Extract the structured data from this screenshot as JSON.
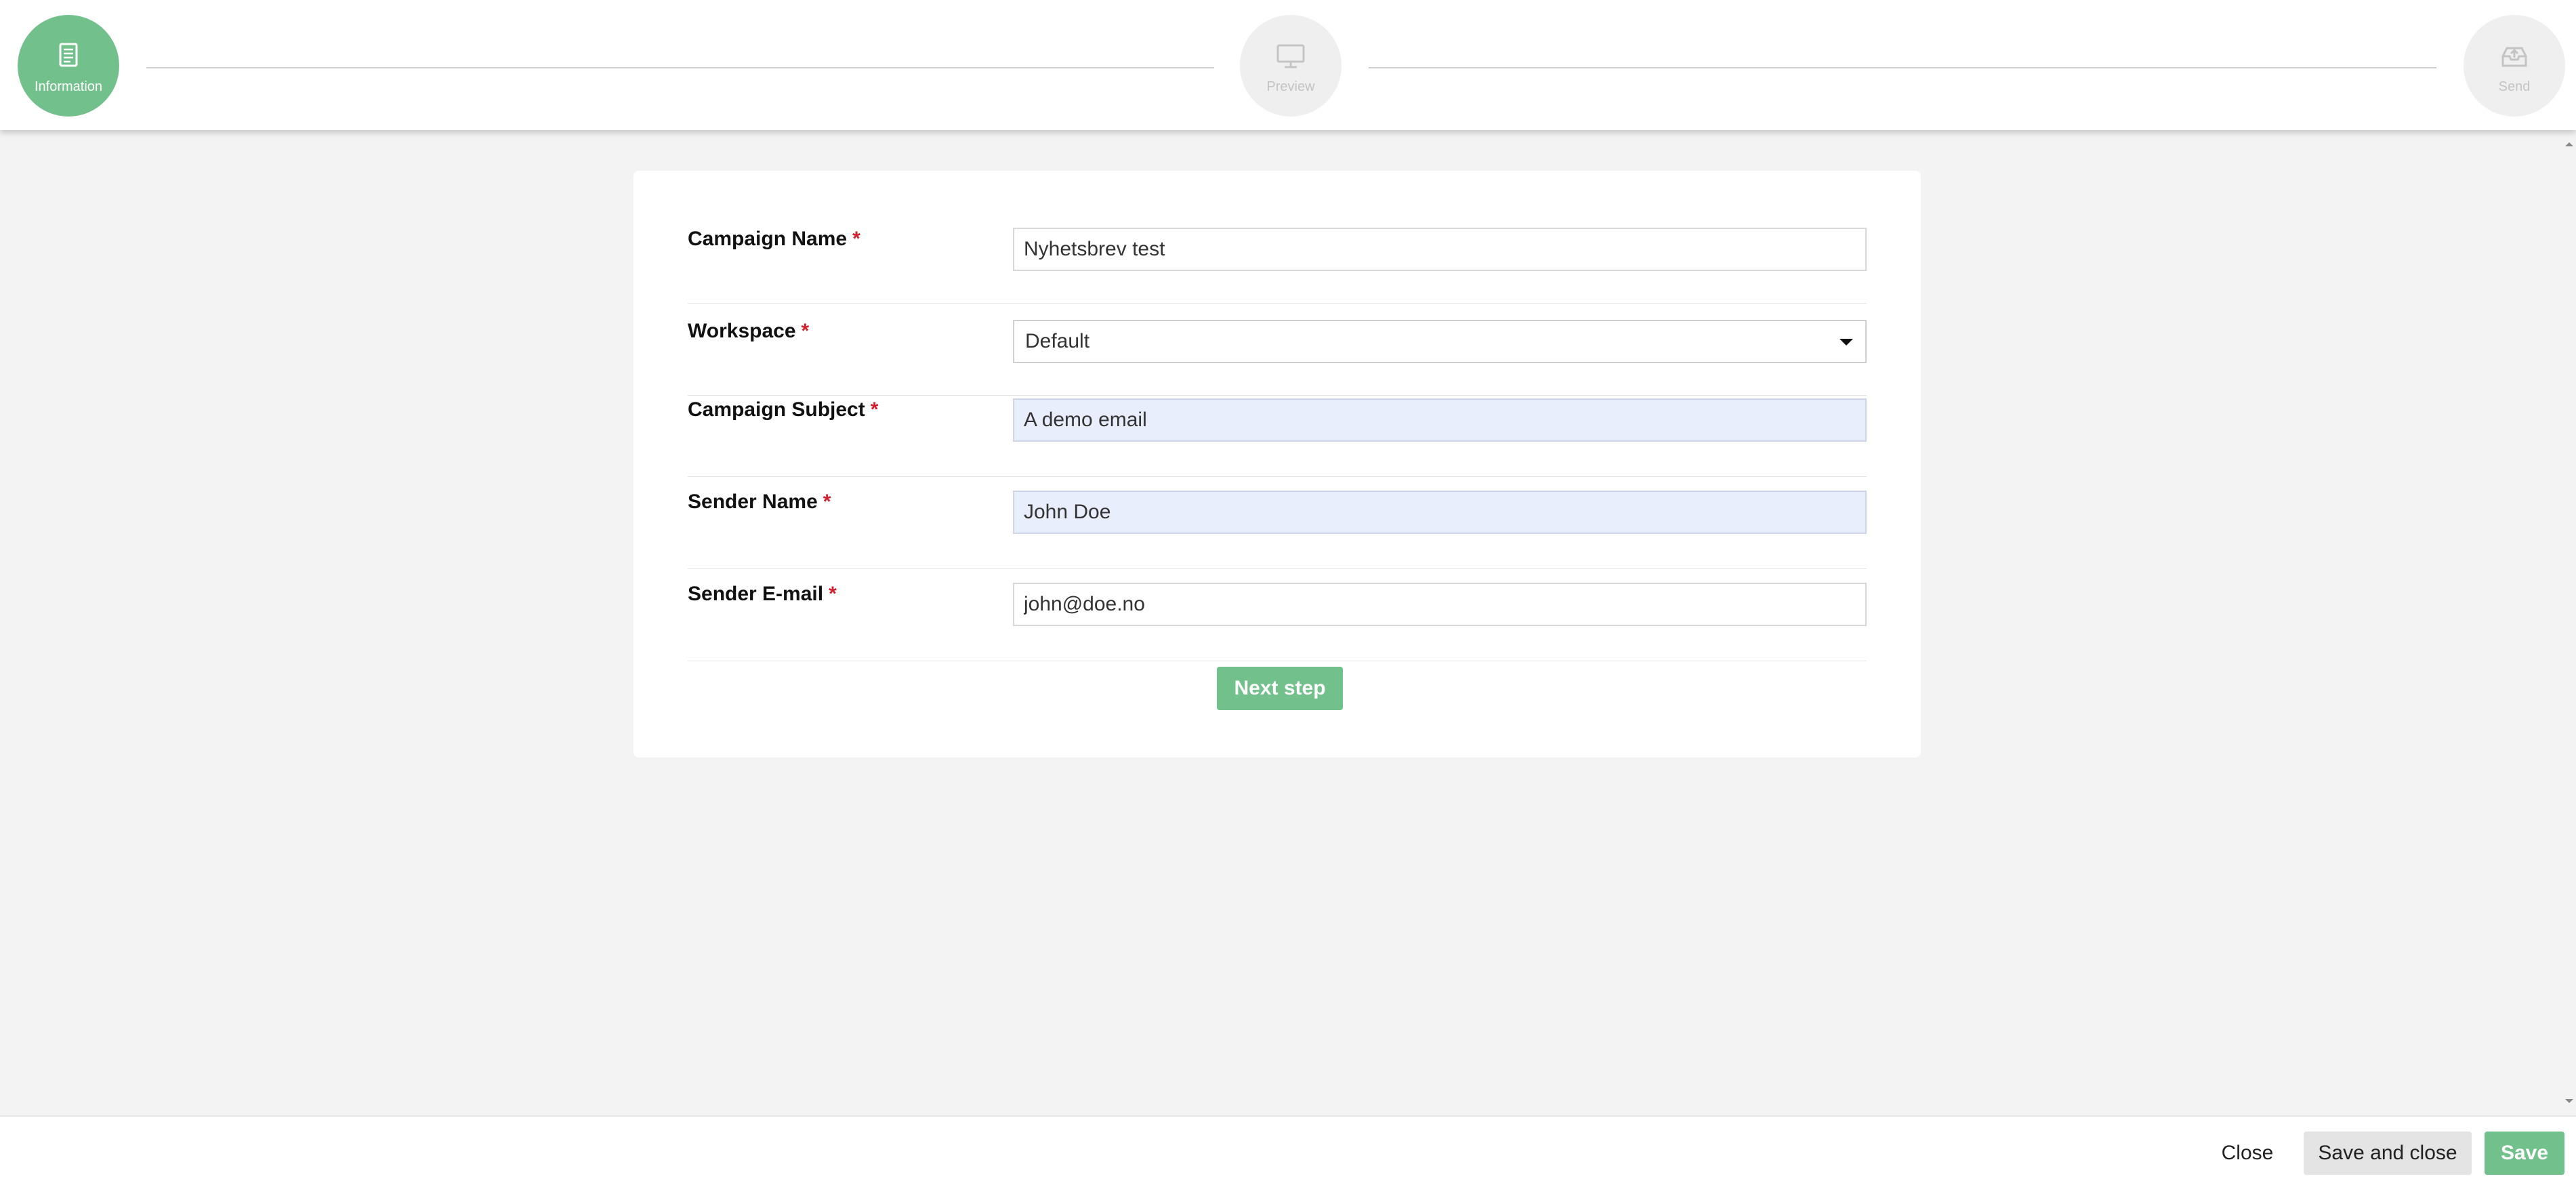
{
  "stepper": {
    "steps": [
      {
        "label": "Information",
        "icon": "document-icon",
        "state": "active"
      },
      {
        "label": "Preview",
        "icon": "monitor-icon",
        "state": "inactive"
      },
      {
        "label": "Send",
        "icon": "inbox-upload-icon",
        "state": "inactive"
      }
    ]
  },
  "form": {
    "fields": [
      {
        "label": "Campaign Name",
        "required": "*",
        "value": "Nyhetsbrev test"
      },
      {
        "label": "Workspace",
        "required": "*",
        "value": "Default"
      },
      {
        "label": "Campaign Subject",
        "required": "*",
        "value": "A demo email"
      },
      {
        "label": "Sender Name",
        "required": "*",
        "value": "John Doe"
      },
      {
        "label": "Sender E-mail",
        "required": "*",
        "value": "john@doe.no"
      }
    ],
    "next_label": "Next step"
  },
  "footer": {
    "close_label": "Close",
    "save_close_label": "Save and close",
    "save_label": "Save"
  },
  "colors": {
    "accent": "#72c08b",
    "required": "#d0202e",
    "autofill": "#e8eefb",
    "background": "#f3f3f3"
  }
}
